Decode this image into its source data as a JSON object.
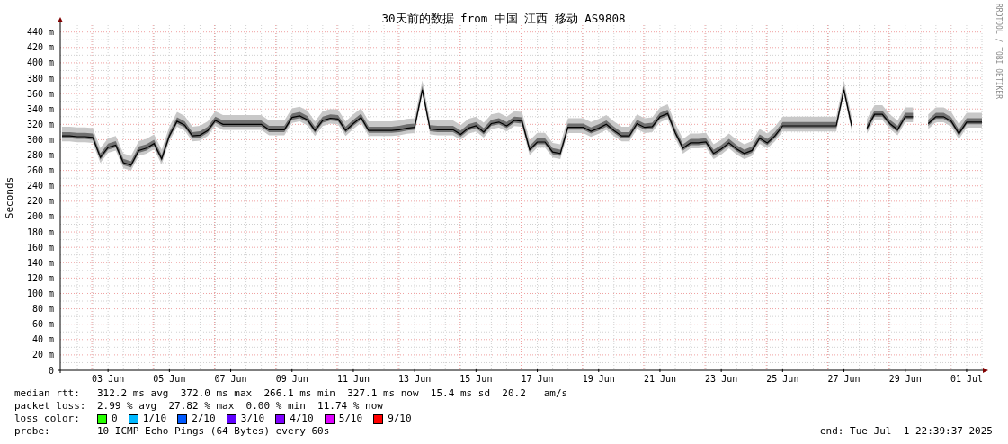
{
  "chart": {
    "watermark": "RRDTOOL / TOBI OETIKER",
    "chart_data": {
      "type": "line",
      "grid": true,
      "title": "30天前的数据 from 中国 江西 移动 AS9808",
      "ylabel": "Seconds",
      "ylim": [
        0,
        449
      ],
      "yticks": [
        {
          "value": 0,
          "label": "0"
        },
        {
          "value": 20,
          "label": "20 m"
        },
        {
          "value": 40,
          "label": "40 m"
        },
        {
          "value": 60,
          "label": "60 m"
        },
        {
          "value": 80,
          "label": "80 m"
        },
        {
          "value": 100,
          "label": "100 m"
        },
        {
          "value": 120,
          "label": "120 m"
        },
        {
          "value": 140,
          "label": "140 m"
        },
        {
          "value": 160,
          "label": "160 m"
        },
        {
          "value": 180,
          "label": "180 m"
        },
        {
          "value": 200,
          "label": "200 m"
        },
        {
          "value": 220,
          "label": "220 m"
        },
        {
          "value": 240,
          "label": "240 m"
        },
        {
          "value": 260,
          "label": "260 m"
        },
        {
          "value": 280,
          "label": "280 m"
        },
        {
          "value": 300,
          "label": "300 m"
        },
        {
          "value": 320,
          "label": "320 m"
        },
        {
          "value": 340,
          "label": "340 m"
        },
        {
          "value": 360,
          "label": "360 m"
        },
        {
          "value": 380,
          "label": "380 m"
        },
        {
          "value": 400,
          "label": "400 m"
        },
        {
          "value": 420,
          "label": "420 m"
        },
        {
          "value": 440,
          "label": "440 m"
        }
      ],
      "categories": [
        null,
        null,
        null,
        null,
        null,
        null,
        "03 Jun",
        null,
        null,
        null,
        null,
        null,
        null,
        null,
        "05 Jun",
        null,
        null,
        null,
        null,
        null,
        null,
        null,
        "07 Jun",
        null,
        null,
        null,
        null,
        null,
        null,
        null,
        "09 Jun",
        null,
        null,
        null,
        null,
        null,
        null,
        null,
        "11 Jun",
        null,
        null,
        null,
        null,
        null,
        null,
        null,
        "13 Jun",
        null,
        null,
        null,
        null,
        null,
        null,
        null,
        "15 Jun",
        null,
        null,
        null,
        null,
        null,
        null,
        null,
        "17 Jun",
        null,
        null,
        null,
        null,
        null,
        null,
        null,
        "19 Jun",
        null,
        null,
        null,
        null,
        null,
        null,
        null,
        "21 Jun",
        null,
        null,
        null,
        null,
        null,
        null,
        null,
        "23 Jun",
        null,
        null,
        null,
        null,
        null,
        null,
        null,
        "25 Jun",
        null,
        null,
        null,
        null,
        null,
        null,
        null,
        "27 Jun",
        null,
        null,
        null,
        null,
        null,
        null,
        null,
        "29 Jun",
        null,
        null,
        null,
        null,
        null,
        null,
        null,
        "01 Jul",
        null,
        null
      ],
      "series": [
        {
          "color": "#000000",
          "values": [
            305,
            305,
            304,
            304,
            303,
            277,
            290,
            293,
            270,
            267,
            286,
            289,
            295,
            275,
            305,
            324,
            319,
            305,
            306,
            312,
            325,
            320,
            320,
            320,
            320,
            320,
            320,
            313,
            313,
            313,
            329,
            331,
            326,
            312,
            325,
            328,
            327,
            312,
            321,
            329,
            312,
            312,
            312,
            312,
            313,
            315,
            316,
            365,
            314,
            313,
            313,
            313,
            307,
            315,
            318,
            310,
            321,
            323,
            318,
            325,
            324,
            287,
            297,
            297,
            284,
            282,
            316,
            316,
            316,
            311,
            315,
            320,
            312,
            305,
            305,
            321,
            316,
            317,
            330,
            334,
            309,
            289,
            296,
            296,
            297,
            282,
            288,
            296,
            288,
            282,
            286,
            302,
            296,
            305,
            318,
            318,
            318,
            318,
            318,
            318,
            318,
            318,
            365,
            318,
            null,
            315,
            333,
            333,
            321,
            313,
            330,
            330,
            null,
            321,
            330,
            330,
            324,
            308,
            323,
            323,
            323
          ]
        }
      ]
    }
  },
  "legend": {
    "rows": [
      {
        "kind": "text",
        "label": "median rtt:",
        "value": "312.2 ms avg  372.0 ms max  266.1 ms min  327.1 ms now  15.4 ms sd  20.2   am/s"
      },
      {
        "kind": "text",
        "label": "packet loss:",
        "value": "2.99 % avg  27.82 % max  0.00 % min  11.74 % now"
      },
      {
        "kind": "swatches",
        "label": "loss color:",
        "items": [
          {
            "label": "0",
            "color": "#26ff00"
          },
          {
            "label": "1/10",
            "color": "#00b8ff"
          },
          {
            "label": "2/10",
            "color": "#0059ff"
          },
          {
            "label": "3/10",
            "color": "#5e00ff"
          },
          {
            "label": "4/10",
            "color": "#7e00ff"
          },
          {
            "label": "5/10",
            "color": "#dd00ff"
          },
          {
            "label": "9/10",
            "color": "#ff0000"
          }
        ]
      },
      {
        "kind": "probe",
        "label": "probe:",
        "value": "10 ICMP Echo Pings (64 Bytes) every 60s",
        "end": "end: Tue Jul  1 22:39:37 2025"
      }
    ]
  }
}
